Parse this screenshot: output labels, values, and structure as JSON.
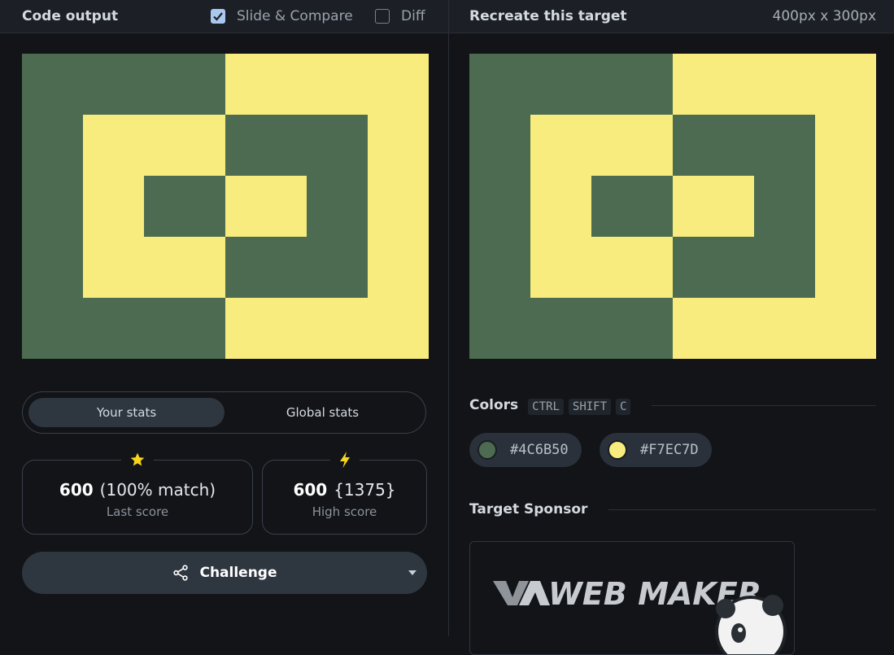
{
  "left": {
    "title": "Code output",
    "slide_compare": {
      "label": "Slide & Compare",
      "checked": true
    },
    "diff": {
      "label": "Diff",
      "checked": false
    }
  },
  "right": {
    "title": "Recreate this target",
    "dimensions": "400px x 300px"
  },
  "stats_tabs": {
    "active": "Your stats",
    "inactive": "Global stats"
  },
  "last_score": {
    "score": "600",
    "match": "(100% match)",
    "label": "Last score",
    "icon": "star-icon"
  },
  "high_score": {
    "score": "600",
    "extra": "{1375}",
    "label": "High score",
    "icon": "bolt-icon"
  },
  "challenge": {
    "label": "Challenge",
    "icon": "share-icon"
  },
  "colors": {
    "label": "Colors",
    "shortcut": [
      "CTRL",
      "SHIFT",
      "C"
    ],
    "items": [
      {
        "hex": "#4C6B50",
        "color": "#4c6b50"
      },
      {
        "hex": "#F7EC7D",
        "color": "#f7ec7d"
      }
    ]
  },
  "sponsor": {
    "label": "Target Sponsor",
    "logo_text": "WEB MAKER"
  }
}
